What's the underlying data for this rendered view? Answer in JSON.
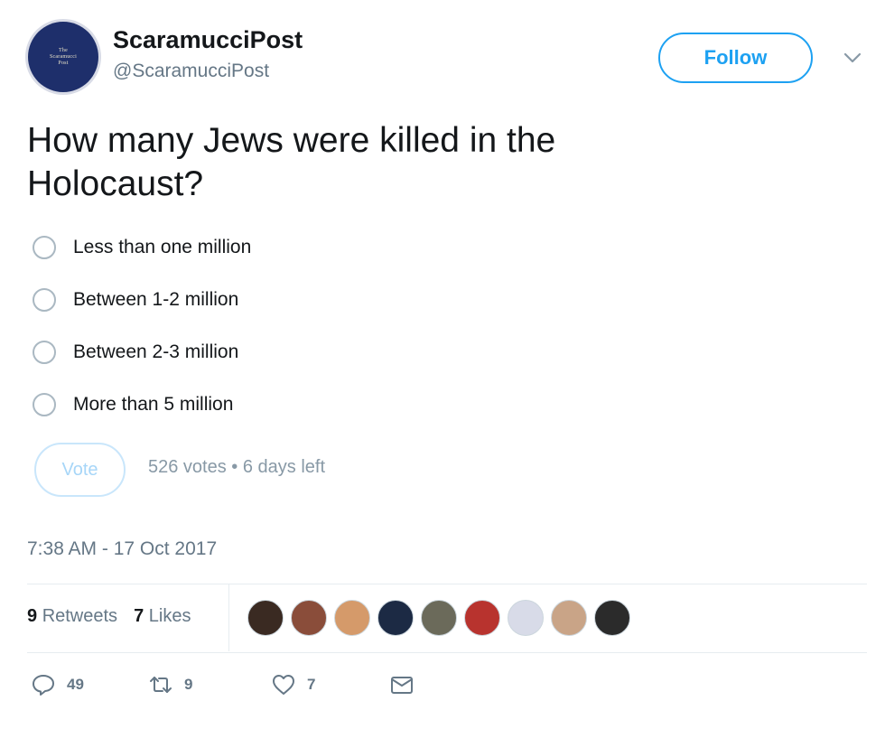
{
  "header": {
    "display_name": "ScaramucciPost",
    "screen_name": "@ScaramucciPost",
    "follow_label": "Follow",
    "avatar_text": [
      "The",
      "Scaramucci",
      "Post"
    ]
  },
  "tweet": {
    "question": "How many Jews were killed in the Holocaust?",
    "timestamp": "7:38 AM - 17 Oct 2017"
  },
  "poll": {
    "options": [
      {
        "label": "Less than one million"
      },
      {
        "label": "Between 1-2 million"
      },
      {
        "label": "Between 2-3 million"
      },
      {
        "label": "More than 5 million"
      }
    ],
    "vote_label": "Vote",
    "meta": "526 votes • 6 days left"
  },
  "stats": {
    "retweets_count": "9",
    "retweets_label": "Retweets",
    "likes_count": "7",
    "likes_label": "Likes"
  },
  "likers": [
    {
      "color": "#3a2a22"
    },
    {
      "color": "#8a4d3a"
    },
    {
      "color": "#d59a6a"
    },
    {
      "color": "#1c2a44"
    },
    {
      "color": "#6b6a5a"
    },
    {
      "color": "#b8332e"
    },
    {
      "color": "#d8dbe8"
    },
    {
      "color": "#c9a487"
    },
    {
      "color": "#2b2b2b"
    }
  ],
  "actions": {
    "reply_count": "49",
    "retweet_count": "9",
    "like_count": "7"
  },
  "colors": {
    "accent": "#1da1f2",
    "muted": "#657786"
  }
}
